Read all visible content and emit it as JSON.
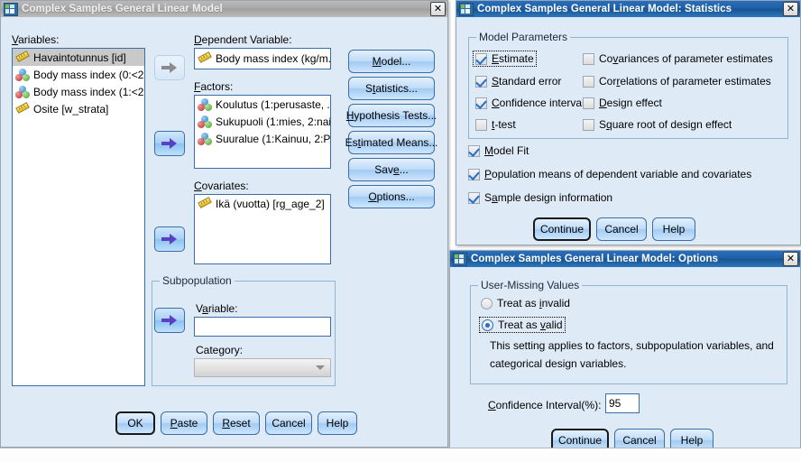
{
  "main_dialog": {
    "title": "Complex Samples General Linear Model",
    "close_label": "✕",
    "variables_label": "Variables:",
    "variables": [
      {
        "label": "Havaintotunnus [id]",
        "icon": "scale-ruler-icon",
        "selected": true
      },
      {
        "label": "Body mass index (0:<2...",
        "icon": "nominal-icon",
        "selected": false
      },
      {
        "label": "Body mass index (1:<2...",
        "icon": "nominal-icon",
        "selected": false
      },
      {
        "label": "Osite [w_strata]",
        "icon": "scale-ruler-icon",
        "selected": false
      }
    ],
    "dependent_label": "Dependent Variable:",
    "dependent_value": "Body mass index (kg/m...",
    "factors_label": "Factors:",
    "factors": [
      "Koulutus (1:perusaste, ...",
      "Sukupuoli (1:mies, 2:nai...",
      "Suuralue (1:Kainuu, 2:P..."
    ],
    "covariates_label": "Covariates:",
    "covariates": [
      "Ikä (vuotta) [rg_age_2]"
    ],
    "subpopulation": {
      "group_label": "Subpopulation",
      "variable_label": "Variable:",
      "variable_value": "",
      "category_label": "Category:",
      "category_value": ""
    },
    "side_buttons": [
      {
        "label": "Model...",
        "accel": "M"
      },
      {
        "label": "Statistics...",
        "accel": "t"
      },
      {
        "label": "Hypothesis Tests...",
        "accel": "H"
      },
      {
        "label": "Estimated Means...",
        "accel": "t"
      },
      {
        "label": "Save...",
        "accel": "e"
      },
      {
        "label": "Options...",
        "accel": "O"
      }
    ],
    "footer_buttons": [
      "OK",
      "Paste",
      "Reset",
      "Cancel",
      "Help"
    ]
  },
  "statistics_dialog": {
    "title": "Complex Samples General Linear Model: Statistics",
    "close_label": "✕",
    "group_label": "Model Parameters",
    "left_checks": [
      {
        "label": "Estimate",
        "checked": true,
        "focused": true
      },
      {
        "label": "Standard error",
        "checked": true,
        "focused": false
      },
      {
        "label": "Confidence interval",
        "checked": true,
        "focused": false
      },
      {
        "label": "t-test",
        "checked": false,
        "focused": false
      }
    ],
    "right_checks": [
      {
        "label": "Covariances of parameter estimates",
        "checked": false
      },
      {
        "label": "Correlations of parameter estimates",
        "checked": false
      },
      {
        "label": "Design effect",
        "checked": false
      },
      {
        "label": "Square root of design effect",
        "checked": false
      }
    ],
    "bottom_checks": [
      {
        "label": "Model Fit",
        "checked": true
      },
      {
        "label": "Population means of dependent variable and covariates",
        "checked": true
      },
      {
        "label": "Sample design information",
        "checked": true
      }
    ],
    "footer_buttons": [
      "Continue",
      "Cancel",
      "Help"
    ]
  },
  "options_dialog": {
    "title": "Complex Samples General Linear Model: Options",
    "close_label": "✕",
    "group_label": "User-Missing Values",
    "radios": [
      {
        "label": "Treat as invalid",
        "checked": false,
        "focused": false
      },
      {
        "label": "Treat as valid",
        "checked": true,
        "focused": true
      }
    ],
    "note_line1": "This setting applies to factors, subpopulation variables, and",
    "note_line2": "categorical design variables.",
    "ci_label": "Confidence Interval(%):",
    "ci_value": "95",
    "footer_buttons": [
      "Continue",
      "Cancel",
      "Help"
    ]
  },
  "colors": {
    "dialog_background": "#dfeaf7",
    "active_title": "#1f5fa8",
    "inactive_title": "#a8a8a8",
    "field_border": "#3a6ea5",
    "check_mark": "#1d6fd0"
  }
}
